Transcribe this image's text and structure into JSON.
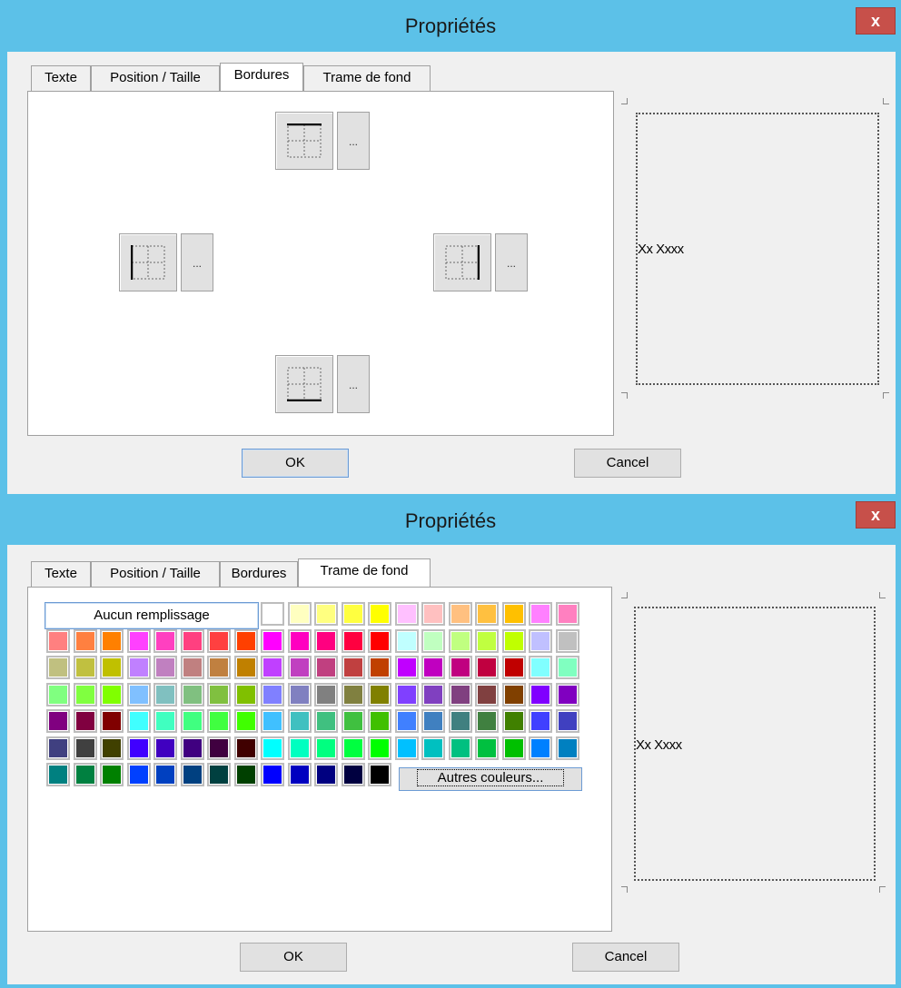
{
  "dialog1": {
    "title": "Propriétés",
    "close_label": "x",
    "tabs": [
      {
        "label": "Texte",
        "active": false
      },
      {
        "label": "Position / Taille",
        "active": false
      },
      {
        "label": "Bordures",
        "active": true
      },
      {
        "label": "Trame de fond",
        "active": false
      }
    ],
    "border_buttons": [
      {
        "name": "border-top",
        "more_label": "..."
      },
      {
        "name": "border-left",
        "more_label": "..."
      },
      {
        "name": "border-right",
        "more_label": "..."
      },
      {
        "name": "border-bottom",
        "more_label": "..."
      }
    ],
    "preview_text": "Xx Xxxx",
    "ok_label": "OK",
    "cancel_label": "Cancel"
  },
  "dialog2": {
    "title": "Propriétés",
    "close_label": "x",
    "tabs": [
      {
        "label": "Texte",
        "active": false
      },
      {
        "label": "Position / Taille",
        "active": false
      },
      {
        "label": "Bordures",
        "active": false
      },
      {
        "label": "Trame de fond",
        "active": true
      }
    ],
    "no_fill_label": "Aucun remplissage",
    "more_colors_label": "Autres couleurs...",
    "preview_text": "Xx Xxxx",
    "ok_label": "OK",
    "cancel_label": "Cancel",
    "palette": [
      [
        "#ffffff",
        "#ffffc0",
        "#ffff80",
        "#ffff40",
        "#ffff00",
        "#ffc0ff",
        "#ffc0c0",
        "#ffc080",
        "#ffc040",
        "#ffc000",
        "#ff80ff",
        "#ff80c0"
      ],
      [
        "#ff8080",
        "#ff8040",
        "#ff8000",
        "#ff40ff",
        "#ff40c0",
        "#ff4080",
        "#ff4040",
        "#ff4000",
        "#ff00ff",
        "#ff00c0",
        "#ff0080",
        "#ff0040",
        "#ff0000",
        "#c0ffff",
        "#c0ffc0",
        "#c0ff80",
        "#c0ff40",
        "#c0ff00",
        "#c0c0ff",
        "#c0c0c0"
      ],
      [
        "#c0c080",
        "#c0c040",
        "#c0c000",
        "#c080ff",
        "#c080c0",
        "#c08080",
        "#c08040",
        "#c08000",
        "#c040ff",
        "#c040c0",
        "#c04080",
        "#c04040",
        "#c04000",
        "#c000ff",
        "#c000c0",
        "#c00080",
        "#c00040",
        "#c00000",
        "#80ffff",
        "#80ffc0"
      ],
      [
        "#80ff80",
        "#80ff40",
        "#80ff00",
        "#80c0ff",
        "#80c0c0",
        "#80c080",
        "#80c040",
        "#80c000",
        "#8080ff",
        "#8080c0",
        "#808080",
        "#808040",
        "#808000",
        "#8040ff",
        "#8040c0",
        "#804080",
        "#804040",
        "#804000",
        "#8000ff",
        "#8000c0"
      ],
      [
        "#800080",
        "#800040",
        "#800000",
        "#40ffff",
        "#40ffc0",
        "#40ff80",
        "#40ff40",
        "#40ff00",
        "#40c0ff",
        "#40c0c0",
        "#40c080",
        "#40c040",
        "#40c000",
        "#4080ff",
        "#4080c0",
        "#408080",
        "#408040",
        "#408000",
        "#4040ff",
        "#4040c0"
      ],
      [
        "#404080",
        "#404040",
        "#404000",
        "#4000ff",
        "#4000c0",
        "#400080",
        "#400040",
        "#400000",
        "#00ffff",
        "#00ffc0",
        "#00ff80",
        "#00ff40",
        "#00ff00",
        "#00c0ff",
        "#00c0c0",
        "#00c080",
        "#00c040",
        "#00c000",
        "#0080ff",
        "#0080c0"
      ],
      [
        "#008080",
        "#008040",
        "#008000",
        "#0040ff",
        "#0040c0",
        "#004080",
        "#004040",
        "#004000",
        "#0000ff",
        "#0000c0",
        "#000080",
        "#000040",
        "#000000"
      ]
    ]
  }
}
